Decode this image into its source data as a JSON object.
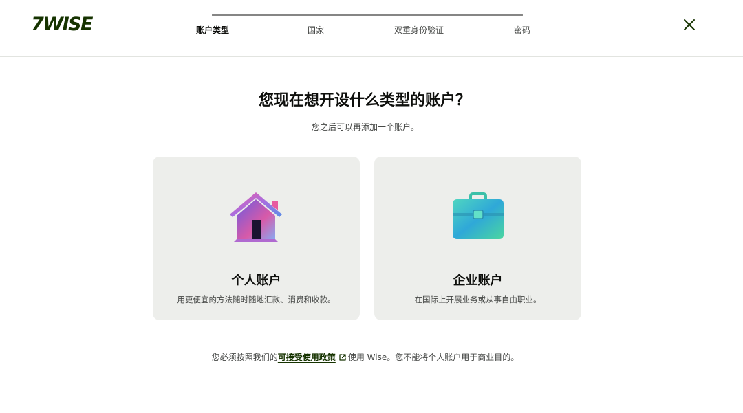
{
  "brand": {
    "logo_text": "7WISE",
    "color": "#163300"
  },
  "stepper": {
    "steps": [
      {
        "label": "账户类型",
        "active": true
      },
      {
        "label": "国家",
        "active": false
      },
      {
        "label": "双重身份验证",
        "active": false
      },
      {
        "label": "密码",
        "active": false
      }
    ],
    "progress": 0.0
  },
  "close_icon": "close-icon",
  "main": {
    "title": "您现在想开设什么类型的账户？",
    "subtitle": "您之后可以再添加一个账户。",
    "cards": [
      {
        "icon": "house-icon",
        "title": "个人账户",
        "description": "用更便宜的方法随时随地汇款、消费和收款。"
      },
      {
        "icon": "briefcase-icon",
        "title": "企业账户",
        "description": "在国际上开展业务或从事自由职业。"
      }
    ]
  },
  "footer": {
    "prefix": "您必须按照我们的",
    "link_label": "可接受使用政策",
    "link_icon": "external-link-icon",
    "suffix": "使用 Wise。您不能将个人账户用于商业目的。"
  },
  "colors": {
    "card_bg": "#edeeeb",
    "text_primary": "#0e0f0c",
    "text_secondary": "#454745",
    "accent_green": "#163300"
  }
}
